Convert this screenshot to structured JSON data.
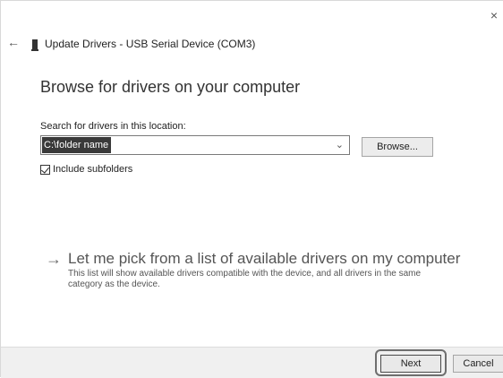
{
  "window": {
    "title": "Update Drivers - USB Serial Device (COM3)",
    "close_icon": "×",
    "back_icon": "←"
  },
  "main": {
    "heading": "Browse for drivers on your computer",
    "search_label": "Search for drivers in this location:",
    "location_value": "C:\\folder name",
    "browse_label": "Browse...",
    "include_subfolders_label": "Include subfolders",
    "include_subfolders_checked": true
  },
  "pick_option": {
    "arrow": "→",
    "title": "Let me pick from a list of available drivers on my computer",
    "description": "This list will show available drivers compatible with the device, and all drivers in the same category as the device."
  },
  "footer": {
    "next_label": "Next",
    "cancel_label": "Cancel"
  }
}
